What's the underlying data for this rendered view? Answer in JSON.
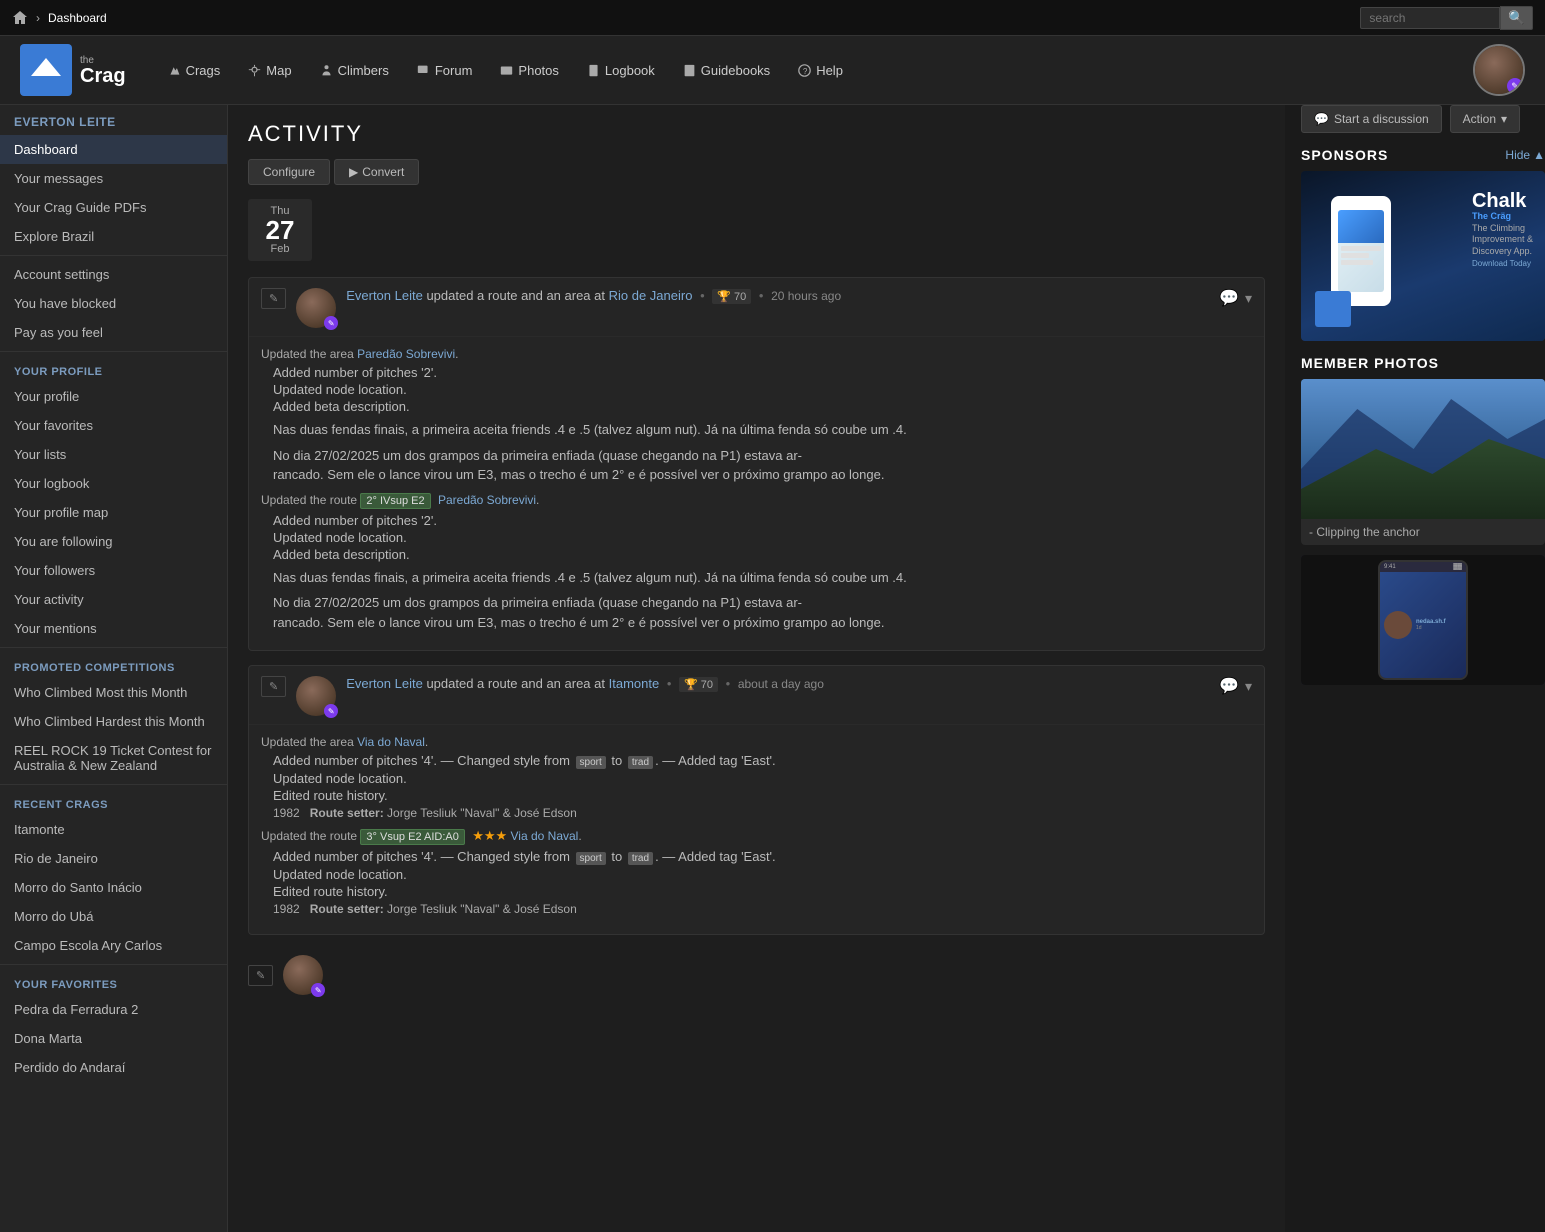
{
  "topbar": {
    "home_icon": "🏠",
    "separator": "›",
    "title": "Dashboard",
    "search_placeholder": "search",
    "search_btn": "🔍"
  },
  "header": {
    "logo_line1": "the",
    "logo_line2": "Crag",
    "nav": [
      {
        "label": "Crags",
        "icon": "crags-icon"
      },
      {
        "label": "Map",
        "icon": "map-icon"
      },
      {
        "label": "Climbers",
        "icon": "climbers-icon"
      },
      {
        "label": "Forum",
        "icon": "forum-icon"
      },
      {
        "label": "Photos",
        "icon": "photos-icon"
      },
      {
        "label": "Logbook",
        "icon": "logbook-icon"
      },
      {
        "label": "Guidebooks",
        "icon": "guidebooks-icon"
      },
      {
        "label": "Help",
        "icon": "help-icon"
      }
    ]
  },
  "sidebar": {
    "user_section": "Everton Leite",
    "items_top": [
      {
        "label": "Dashboard",
        "active": true
      },
      {
        "label": "Your messages"
      },
      {
        "label": "Your Crag Guide PDFs"
      },
      {
        "label": "Explore Brazil"
      }
    ],
    "items_account": [
      {
        "label": "Account settings"
      },
      {
        "label": "You have blocked"
      },
      {
        "label": "Pay as you feel"
      }
    ],
    "profile_section": "Your Profile",
    "items_profile": [
      {
        "label": "Your profile"
      },
      {
        "label": "Your favorites"
      },
      {
        "label": "Your lists"
      },
      {
        "label": "Your logbook"
      },
      {
        "label": "Your profile map"
      },
      {
        "label": "You are following"
      },
      {
        "label": "Your followers"
      },
      {
        "label": "Your activity"
      },
      {
        "label": "Your mentions"
      }
    ],
    "competitions_section": "Promoted Competitions",
    "items_competitions": [
      {
        "label": "Who Climbed Most this Month"
      },
      {
        "label": "Who Climbed Hardest this Month"
      },
      {
        "label": "REEL ROCK 19 Ticket Contest for Australia & New Zealand"
      }
    ],
    "recent_crags_section": "Recent Crags",
    "items_crags": [
      {
        "label": "Itamonte"
      },
      {
        "label": "Rio de Janeiro"
      },
      {
        "label": "Morro do Santo Inácio"
      },
      {
        "label": "Morro do Ubá"
      },
      {
        "label": "Campo Escola Ary Carlos"
      }
    ],
    "favorites_section": "Your Favorites",
    "items_favorites": [
      {
        "label": "Pedra da Ferradura 2"
      },
      {
        "label": "Dona Marta"
      },
      {
        "label": "Perdido do Andaraí"
      }
    ]
  },
  "main": {
    "activity_title": "ACTIVITY",
    "configure_btn": "Configure",
    "convert_btn": "Convert",
    "entries": [
      {
        "date_name": "Thu",
        "date_num": "27",
        "date_month": "Feb",
        "user": "Everton Leite",
        "action": "updated a route and an area at",
        "location": "Rio de Janeiro",
        "quality": "70",
        "time": "20 hours ago",
        "sections": [
          {
            "type": "area",
            "area_label": "Updated the area",
            "area_link": "Paredão Sobrevivi",
            "details": [
              "Added number of pitches '2'.",
              "Updated node location.",
              "Added beta description.",
              "Nas duas fendas finais, a primeira aceita friends .4 e .5 (talvez algum nut). Já na última fenda só coube um .4.",
              "No dia 27/02/2025 um dos grampos da primeira enfiada (quase chegando na P1) estava ar-rancado. Sem ele o lance virou um E3, mas o trecho é um 2° e é possível ver o próximo grampo ao longe."
            ]
          },
          {
            "type": "route",
            "route_label": "Updated the route",
            "route_badge": "2° IVsup E2",
            "route_link": "Paredão Sobrevivi",
            "details": [
              "Added number of pitches '2'.",
              "Updated node location.",
              "Added beta description.",
              "Nas duas fendas finais, a primeira aceita friends .4 e .5 (talvez algum nut). Já na última fenda só coube um .4.",
              "No dia 27/02/2025 um dos grampos da primeira enfiada (quase chegando na P1) estava ar-rancado. Sem ele o lance virou um E3, mas o trecho é um 2° e é possível ver o próximo grampo ao longe."
            ]
          }
        ]
      },
      {
        "user": "Everton Leite",
        "action": "updated a route and an area at",
        "location": "Itamonte",
        "quality": "70",
        "time": "about a day ago",
        "sections": [
          {
            "type": "area",
            "area_label": "Updated the area",
            "area_link": "Via do Naval",
            "details": [
              "Added number of pitches '4'.  — Changed style from",
              "Updated node location.",
              "Edited route history."
            ],
            "tags_from": "sport",
            "tags_to": "trad",
            "tag_added": "East",
            "year": "1982",
            "route_setter": "Route setter: Jorge Tesliuk \"Naval\" & José Edson"
          },
          {
            "type": "route",
            "route_label": "Updated the route",
            "route_badge": "3° Vsup E2 AID:A0",
            "route_stars": "★★★",
            "route_link": "Via do Naval",
            "details": [
              "Added number of pitches '4'.  — Changed style from",
              "Updated node location.",
              "Edited route history."
            ],
            "tags_from": "sport",
            "tags_to": "trad",
            "tag_added": "East",
            "year": "1982",
            "route_setter": "Route setter: Jorge Tesliuk \"Naval\" & José Edson"
          }
        ]
      }
    ]
  },
  "right": {
    "start_discussion": "Start a discussion",
    "action_btn": "Action",
    "sponsors_title": "SPONSORS",
    "hide_label": "Hide",
    "chalk_brand": "Chalk",
    "chalk_desc": "The Climbing Improvement & Discovery App.",
    "chalk_crag": "The Cräg",
    "chalk_download": "Download Today",
    "member_photos_title": "MEMBER PHOTOS",
    "photo_caption": "- Clipping the anchor"
  }
}
